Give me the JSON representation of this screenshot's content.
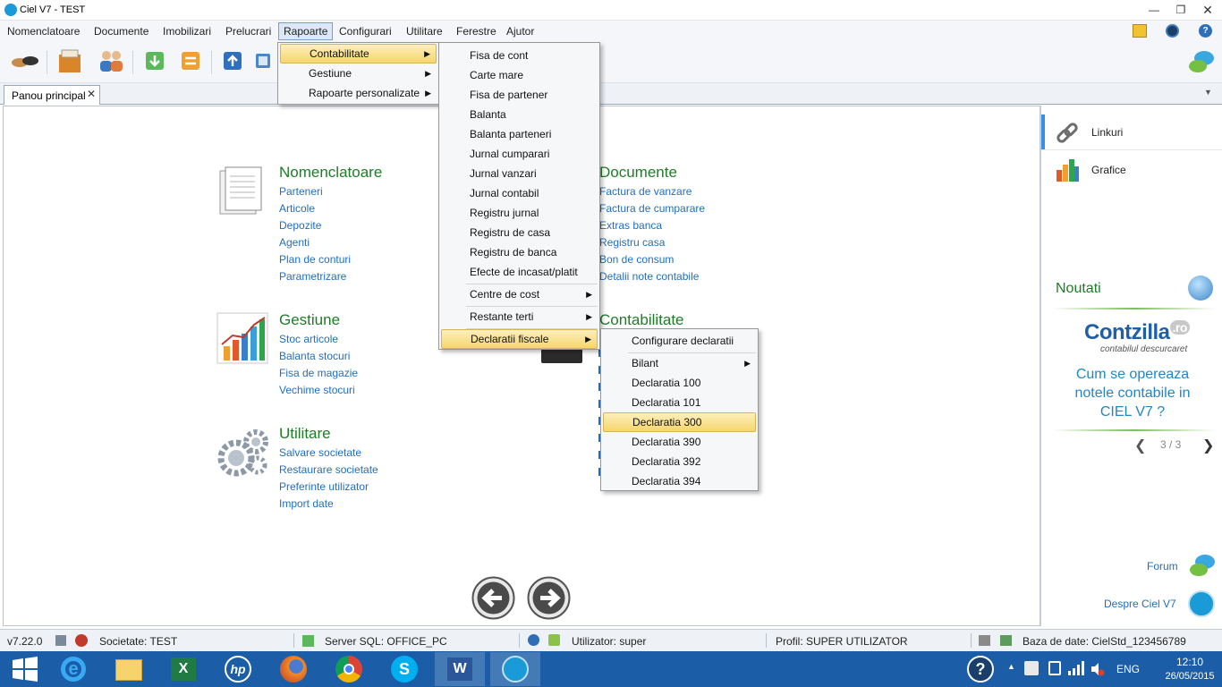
{
  "window": {
    "title": "Ciel V7 - TEST"
  },
  "menubar": {
    "items": [
      "Nomenclatoare",
      "Documente",
      "Imobilizari",
      "Prelucrari",
      "Rapoarte",
      "Configurari",
      "Utilitare",
      "Ferestre",
      "Ajutor"
    ],
    "active": "Rapoarte"
  },
  "tabs": {
    "main": "Panou principal"
  },
  "menu_rapoarte": {
    "items": [
      {
        "label": "Contabilitate",
        "submenu": true,
        "highlighted": true
      },
      {
        "label": "Gestiune",
        "submenu": true
      },
      {
        "label": "Rapoarte personalizate",
        "submenu": true
      }
    ]
  },
  "menu_contabilitate": {
    "items": [
      "Fisa de cont",
      "Carte mare",
      "Fisa de partener",
      "Balanta",
      "Balanta parteneri",
      "Jurnal cumparari",
      "Jurnal vanzari",
      "Jurnal contabil",
      "Registru jurnal",
      "Registru de casa",
      "Registru de banca",
      "Efecte de incasat/platit"
    ],
    "sub_items": [
      "Centre de cost",
      "Restante terti",
      "Declaratii fiscale"
    ]
  },
  "menu_declaratii": {
    "items": [
      "Configurare declaratii",
      "Bilant",
      "Declaratia 100",
      "Declaratia 101",
      "Declaratia 300",
      "Declaratia 390",
      "Declaratia 392",
      "Declaratia 394"
    ],
    "highlighted": "Declaratia 300"
  },
  "sections": {
    "nomenclatoare": {
      "title": "Nomenclatoare",
      "links": [
        "Parteneri",
        "Articole",
        "Depozite",
        "Agenti",
        "Plan de conturi",
        "Parametrizare"
      ]
    },
    "gestiune": {
      "title": "Gestiune",
      "links": [
        "Stoc articole",
        "Balanta stocuri",
        "Fisa de magazie",
        "Vechime stocuri"
      ]
    },
    "utilitare": {
      "title": "Utilitare",
      "links": [
        "Salvare societate",
        "Restaurare societate",
        "Preferinte utilizator",
        "Import date"
      ]
    },
    "documente": {
      "title": "Documente",
      "links": [
        "Factura de vanzare",
        "Factura de cumparare",
        "Extras banca",
        "Registru casa",
        "Bon de consum",
        "Detalii note contabile"
      ]
    },
    "contabilitate": {
      "title": "Contabilitate"
    }
  },
  "rightpanel": {
    "links_label": "Linkuri",
    "charts_label": "Grafice",
    "news_title": "Noutati",
    "brand": "Contzilla",
    "brand_suffix": ".ro",
    "brand_tagline": "contabilul descurcaret",
    "news_text": "Cum se opereaza notele contabile in CIEL V7 ?",
    "pager": "3 / 3",
    "forum": "Forum",
    "about": "Despre Ciel V7"
  },
  "statusbar": {
    "version": "v7.22.0",
    "company": "Societate: TEST",
    "server": "Server SQL: OFFICE_PC",
    "user": "Utilizator: super",
    "profile": "Profil: SUPER UTILIZATOR",
    "database": "Baza de date: CielStd_123456789"
  },
  "taskbar": {
    "apps": [
      "windows-start",
      "internet-explorer",
      "file-explorer",
      "excel",
      "hp",
      "firefox",
      "chrome",
      "skype",
      "word",
      "ciel"
    ],
    "lang": "ENG",
    "time": "12:10",
    "date": "26/05/2015"
  },
  "colors": {
    "section_title": "#1e7d26",
    "link": "#1f6fbf",
    "taskbar": "#1b5ea7",
    "highlight": "#f6d56c"
  }
}
